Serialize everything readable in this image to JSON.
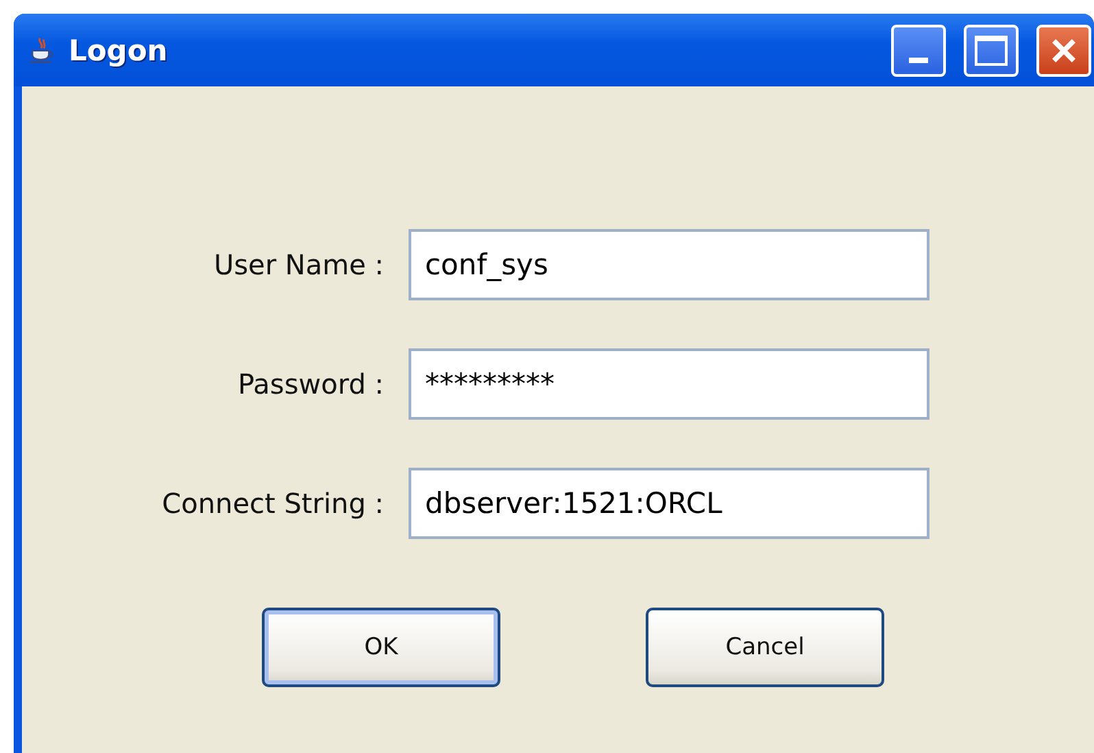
{
  "window": {
    "title": "Logon"
  },
  "fields": [
    {
      "label": "User Name :",
      "value": "conf_sys"
    },
    {
      "label": "Password :",
      "value": "*********"
    },
    {
      "label": "Connect String :",
      "value": "dbserver:1521:ORCL"
    }
  ],
  "buttons": [
    {
      "label": "OK",
      "focused": true
    },
    {
      "label": "Cancel",
      "focused": false
    }
  ]
}
